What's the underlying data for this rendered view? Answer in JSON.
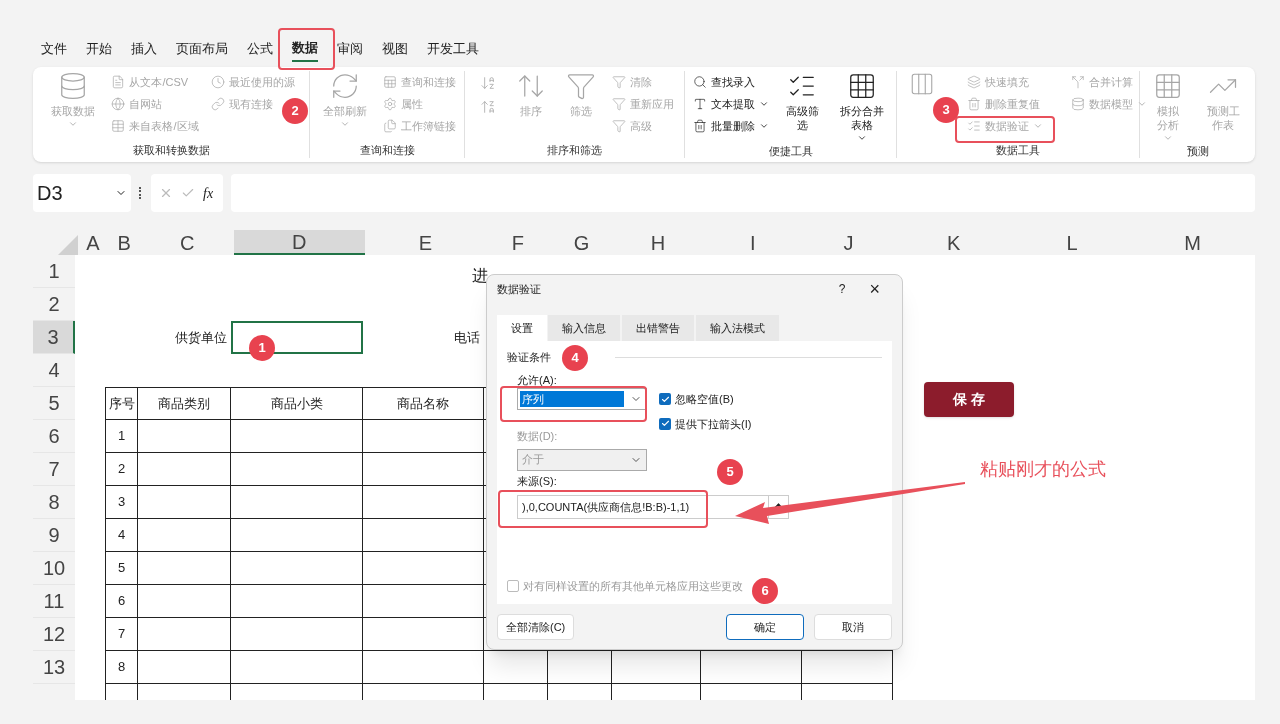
{
  "menu_tabs": [
    {
      "label": "文件",
      "selected": false
    },
    {
      "label": "开始",
      "selected": false
    },
    {
      "label": "插入",
      "selected": false
    },
    {
      "label": "页面布局",
      "selected": false
    },
    {
      "label": "公式",
      "selected": false
    },
    {
      "label": "数据",
      "selected": true
    },
    {
      "label": "审阅",
      "selected": false
    },
    {
      "label": "视图",
      "selected": false
    },
    {
      "label": "开发工具",
      "selected": false
    }
  ],
  "ribbon_groups": [
    {
      "label": "获取和转换数据",
      "columns": [
        [
          {
            "kind": "big",
            "label": "获取数据",
            "disabled": true,
            "has_menu": true
          }
        ],
        [
          {
            "kind": "small",
            "label": "从文本/CSV",
            "disabled": true,
            "has_menu": false
          },
          {
            "kind": "small",
            "label": "自网站",
            "disabled": true,
            "has_menu": false
          },
          {
            "kind": "small",
            "label": "来自表格/区域",
            "disabled": true,
            "has_menu": false
          }
        ],
        [
          {
            "kind": "small",
            "label": "最近使用的源",
            "disabled": true,
            "has_menu": false
          },
          {
            "kind": "small",
            "label": "现有连接",
            "disabled": true,
            "has_menu": false
          }
        ]
      ]
    },
    {
      "label": "查询和连接",
      "columns": [
        [
          {
            "kind": "big",
            "label": "全部刷新",
            "disabled": true,
            "has_menu": true
          }
        ],
        [
          {
            "kind": "small",
            "label": "查询和连接",
            "disabled": true,
            "has_menu": false
          },
          {
            "kind": "small",
            "label": "属性",
            "disabled": true,
            "has_menu": false
          },
          {
            "kind": "small",
            "label": "工作簿链接",
            "disabled": true,
            "has_menu": false
          }
        ]
      ]
    },
    {
      "label": "排序和筛选",
      "columns": [
        [
          {
            "kind": "sort",
            "disabled": true
          },
          {
            "kind": "sort",
            "disabled": true
          }
        ],
        [
          {
            "kind": "big",
            "label": "排序",
            "disabled": true,
            "has_menu": false
          }
        ],
        [
          {
            "kind": "big",
            "label": "筛选",
            "disabled": true,
            "has_menu": false
          }
        ],
        [
          {
            "kind": "small",
            "label": "清除",
            "disabled": true,
            "has_menu": false
          },
          {
            "kind": "small",
            "label": "重新应用",
            "disabled": true,
            "has_menu": false
          },
          {
            "kind": "small",
            "label": "高级",
            "disabled": true,
            "has_menu": false
          }
        ]
      ]
    },
    {
      "label": "便捷工具",
      "columns": [
        [
          {
            "kind": "small",
            "label": "查找录入",
            "disabled": false,
            "has_menu": false
          },
          {
            "kind": "small",
            "label": "文本提取",
            "disabled": false,
            "has_menu": true
          },
          {
            "kind": "small",
            "label": "批量删除",
            "disabled": false,
            "has_menu": true
          }
        ],
        [
          {
            "kind": "big",
            "label": "高级筛选",
            "disabled": false,
            "has_menu": false
          }
        ],
        [
          {
            "kind": "big",
            "label": "拆分合并表格",
            "disabled": false,
            "has_menu": true
          }
        ]
      ]
    },
    {
      "label": "数据工具",
      "columns": [
        [
          {
            "kind": "big",
            "disabled": true,
            "has_menu": false
          }
        ],
        [
          {
            "kind": "small",
            "label": "快速填充",
            "disabled": true,
            "has_menu": false
          },
          {
            "kind": "small",
            "label": "删除重复值",
            "disabled": true,
            "has_menu": false
          },
          {
            "kind": "small",
            "label": "数据验证",
            "disabled": true,
            "has_menu": true
          }
        ],
        [
          {
            "kind": "small",
            "label": "合并计算",
            "disabled": true,
            "has_menu": false
          },
          {
            "kind": "small",
            "label": "数据模型",
            "disabled": true,
            "has_menu": true
          }
        ]
      ]
    },
    {
      "label": "预测",
      "columns": [
        [
          {
            "kind": "big",
            "label": "模拟分析",
            "disabled": true,
            "has_menu": true
          }
        ],
        [
          {
            "kind": "big",
            "label": "预测工作表",
            "disabled": true,
            "has_menu": false
          }
        ]
      ]
    }
  ],
  "name_box": "D3",
  "fx_label": "fx",
  "columns": [
    {
      "label": "A",
      "selected": false
    },
    {
      "label": "B",
      "selected": false
    },
    {
      "label": "C",
      "selected": false
    },
    {
      "label": "D",
      "selected": true
    },
    {
      "label": "E",
      "selected": false
    },
    {
      "label": "F",
      "selected": false
    },
    {
      "label": "G",
      "selected": false
    },
    {
      "label": "H",
      "selected": false
    },
    {
      "label": "I",
      "selected": false
    },
    {
      "label": "J",
      "selected": false
    },
    {
      "label": "K",
      "selected": false
    },
    {
      "label": "L",
      "selected": false
    },
    {
      "label": "M",
      "selected": false
    }
  ],
  "rows": [
    {
      "label": "1",
      "selected": false
    },
    {
      "label": "2",
      "selected": false
    },
    {
      "label": "3",
      "selected": true
    },
    {
      "label": "4",
      "selected": false
    },
    {
      "label": "5",
      "selected": false
    },
    {
      "label": "6",
      "selected": false
    },
    {
      "label": "7",
      "selected": false
    },
    {
      "label": "8",
      "selected": false
    },
    {
      "label": "9",
      "selected": false
    },
    {
      "label": "10",
      "selected": false
    },
    {
      "label": "11",
      "selected": false
    },
    {
      "label": "12",
      "selected": false
    },
    {
      "label": "13",
      "selected": false
    }
  ],
  "sheet": {
    "title": "进",
    "supplier_label": "供货单位",
    "phone_label": "电话",
    "table_headers": [
      "序号",
      "商品类别",
      "商品小类",
      "商品名称"
    ],
    "row_numbers": [
      "1",
      "2",
      "3",
      "4",
      "5",
      "6",
      "7",
      "8"
    ],
    "save_button": "保 存"
  },
  "dialog": {
    "title": "数据验证",
    "help": "?",
    "close": "×",
    "tabs": [
      {
        "label": "设置",
        "selected": true
      },
      {
        "label": "输入信息",
        "selected": false
      },
      {
        "label": "出错警告",
        "selected": false
      },
      {
        "label": "输入法模式",
        "selected": false
      }
    ],
    "section": "验证条件",
    "allow_label": "允许(A):",
    "allow_value": {
      "value": "序列",
      "highlighted": true,
      "disabled": false
    },
    "checkboxes": [
      {
        "label": "忽略空值(B)",
        "checked": true,
        "disabled": false
      },
      {
        "label": "提供下拉箭头(I)",
        "checked": true,
        "disabled": false
      }
    ],
    "data_label": "数据(D):",
    "data_value": {
      "value": "介于",
      "highlighted": false,
      "disabled": true
    },
    "source_label": "来源(S):",
    "source_value": "),0,COUNTA(供应商信息!B:B)-1,1)",
    "apply_all": {
      "label": "对有同样设置的所有其他单元格应用这些更改",
      "checked": false,
      "disabled": true
    },
    "buttons": [
      {
        "label": "全部清除(C)",
        "default": false
      },
      {
        "label": "确定",
        "default": true
      },
      {
        "label": "取消",
        "default": false
      }
    ]
  },
  "annotations": {
    "markers": [
      "1",
      "2",
      "3",
      "4",
      "5",
      "6"
    ],
    "callout": "粘贴刚才的公式"
  }
}
